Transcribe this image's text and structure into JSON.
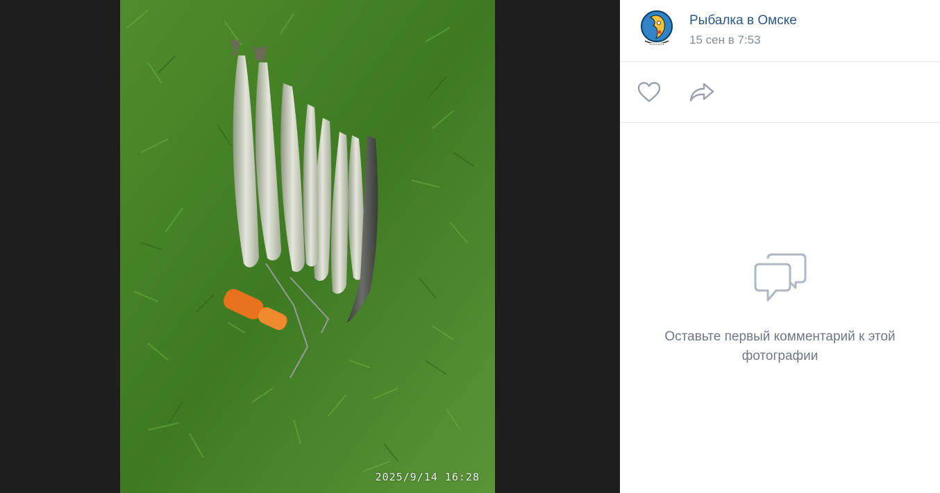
{
  "photo": {
    "timestamp": "2025/9/14 16:28",
    "alt": "fish-catch-on-grass-photo"
  },
  "author": {
    "name": "Рыбалка в Омске",
    "date": "15 сен в 7:53",
    "avatar_icon": "fish-logo-avatar"
  },
  "actions": {
    "like_icon": "heart-icon",
    "share_icon": "share-arrow-icon"
  },
  "comments": {
    "empty_icon": "speech-bubbles-icon",
    "empty_text": "Оставьте первый комментарий к этой фотографии"
  },
  "colors": {
    "author_link": "#2a5885",
    "secondary_text": "#818c99",
    "icon_gray": "#99a2ad",
    "background_dark": "#242424"
  }
}
